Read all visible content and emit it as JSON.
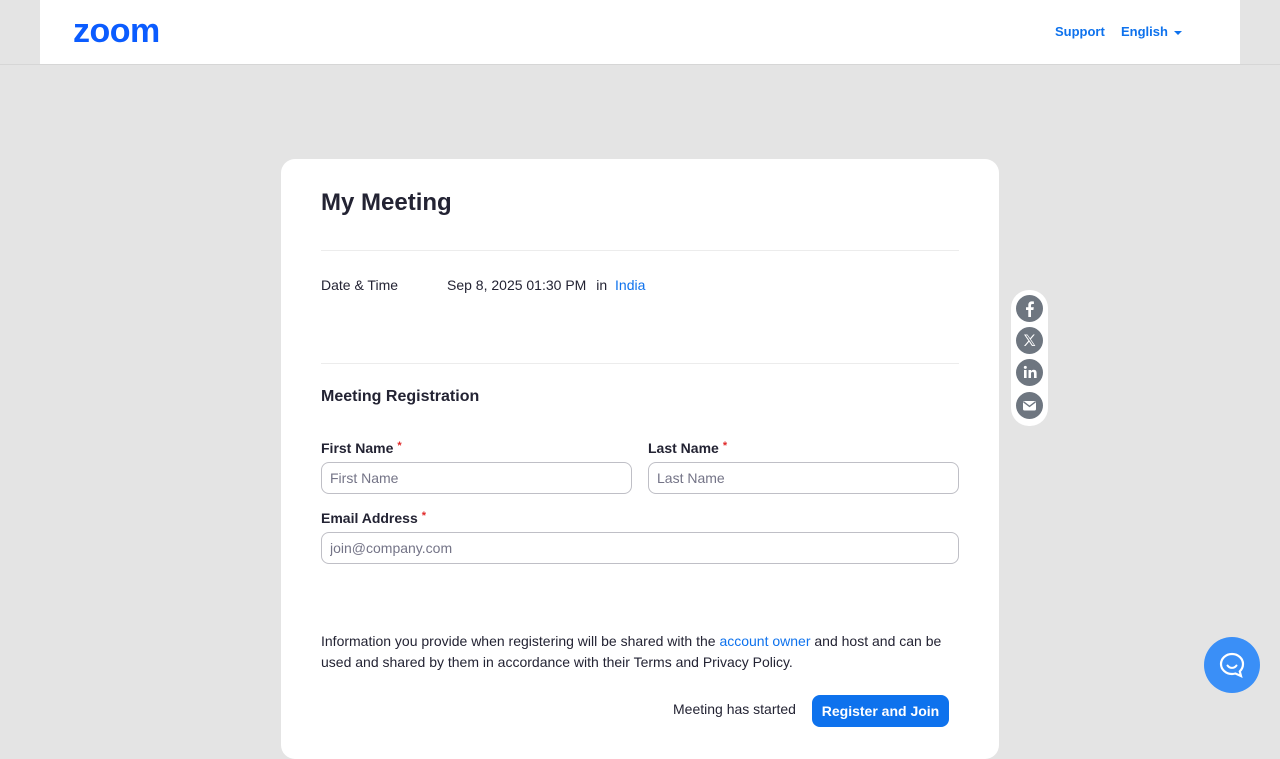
{
  "header": {
    "logo": "zoom",
    "support": "Support",
    "language": "English"
  },
  "meeting": {
    "title": "My Meeting",
    "datetime_label": "Date & Time",
    "datetime_value": "Sep 8, 2025 01:30 PM",
    "in_text": "in",
    "timezone": "India"
  },
  "registration": {
    "title": "Meeting Registration",
    "required_mark": "*",
    "first_name": {
      "label": "First Name",
      "placeholder": "First Name",
      "value": ""
    },
    "last_name": {
      "label": "Last Name",
      "placeholder": "Last Name",
      "value": ""
    },
    "email": {
      "label": "Email Address",
      "placeholder": "join@company.com",
      "value": ""
    },
    "info_before": "Information you provide when registering will be shared with the",
    "info_link": "account owner",
    "info_after": "and host and can be used and shared by them in accordance with their Terms and Privacy Policy.",
    "status": "Meeting has started",
    "register_button": "Register and Join"
  },
  "share": {
    "icons": [
      "facebook-icon",
      "x-icon",
      "linkedin-icon",
      "email-icon"
    ]
  },
  "chat": {
    "icon": "chat-bubble-icon"
  },
  "colors": {
    "brand": "#0b5cff",
    "link": "#0e72ed",
    "background": "#e4e4e4",
    "required": "#e02828"
  }
}
